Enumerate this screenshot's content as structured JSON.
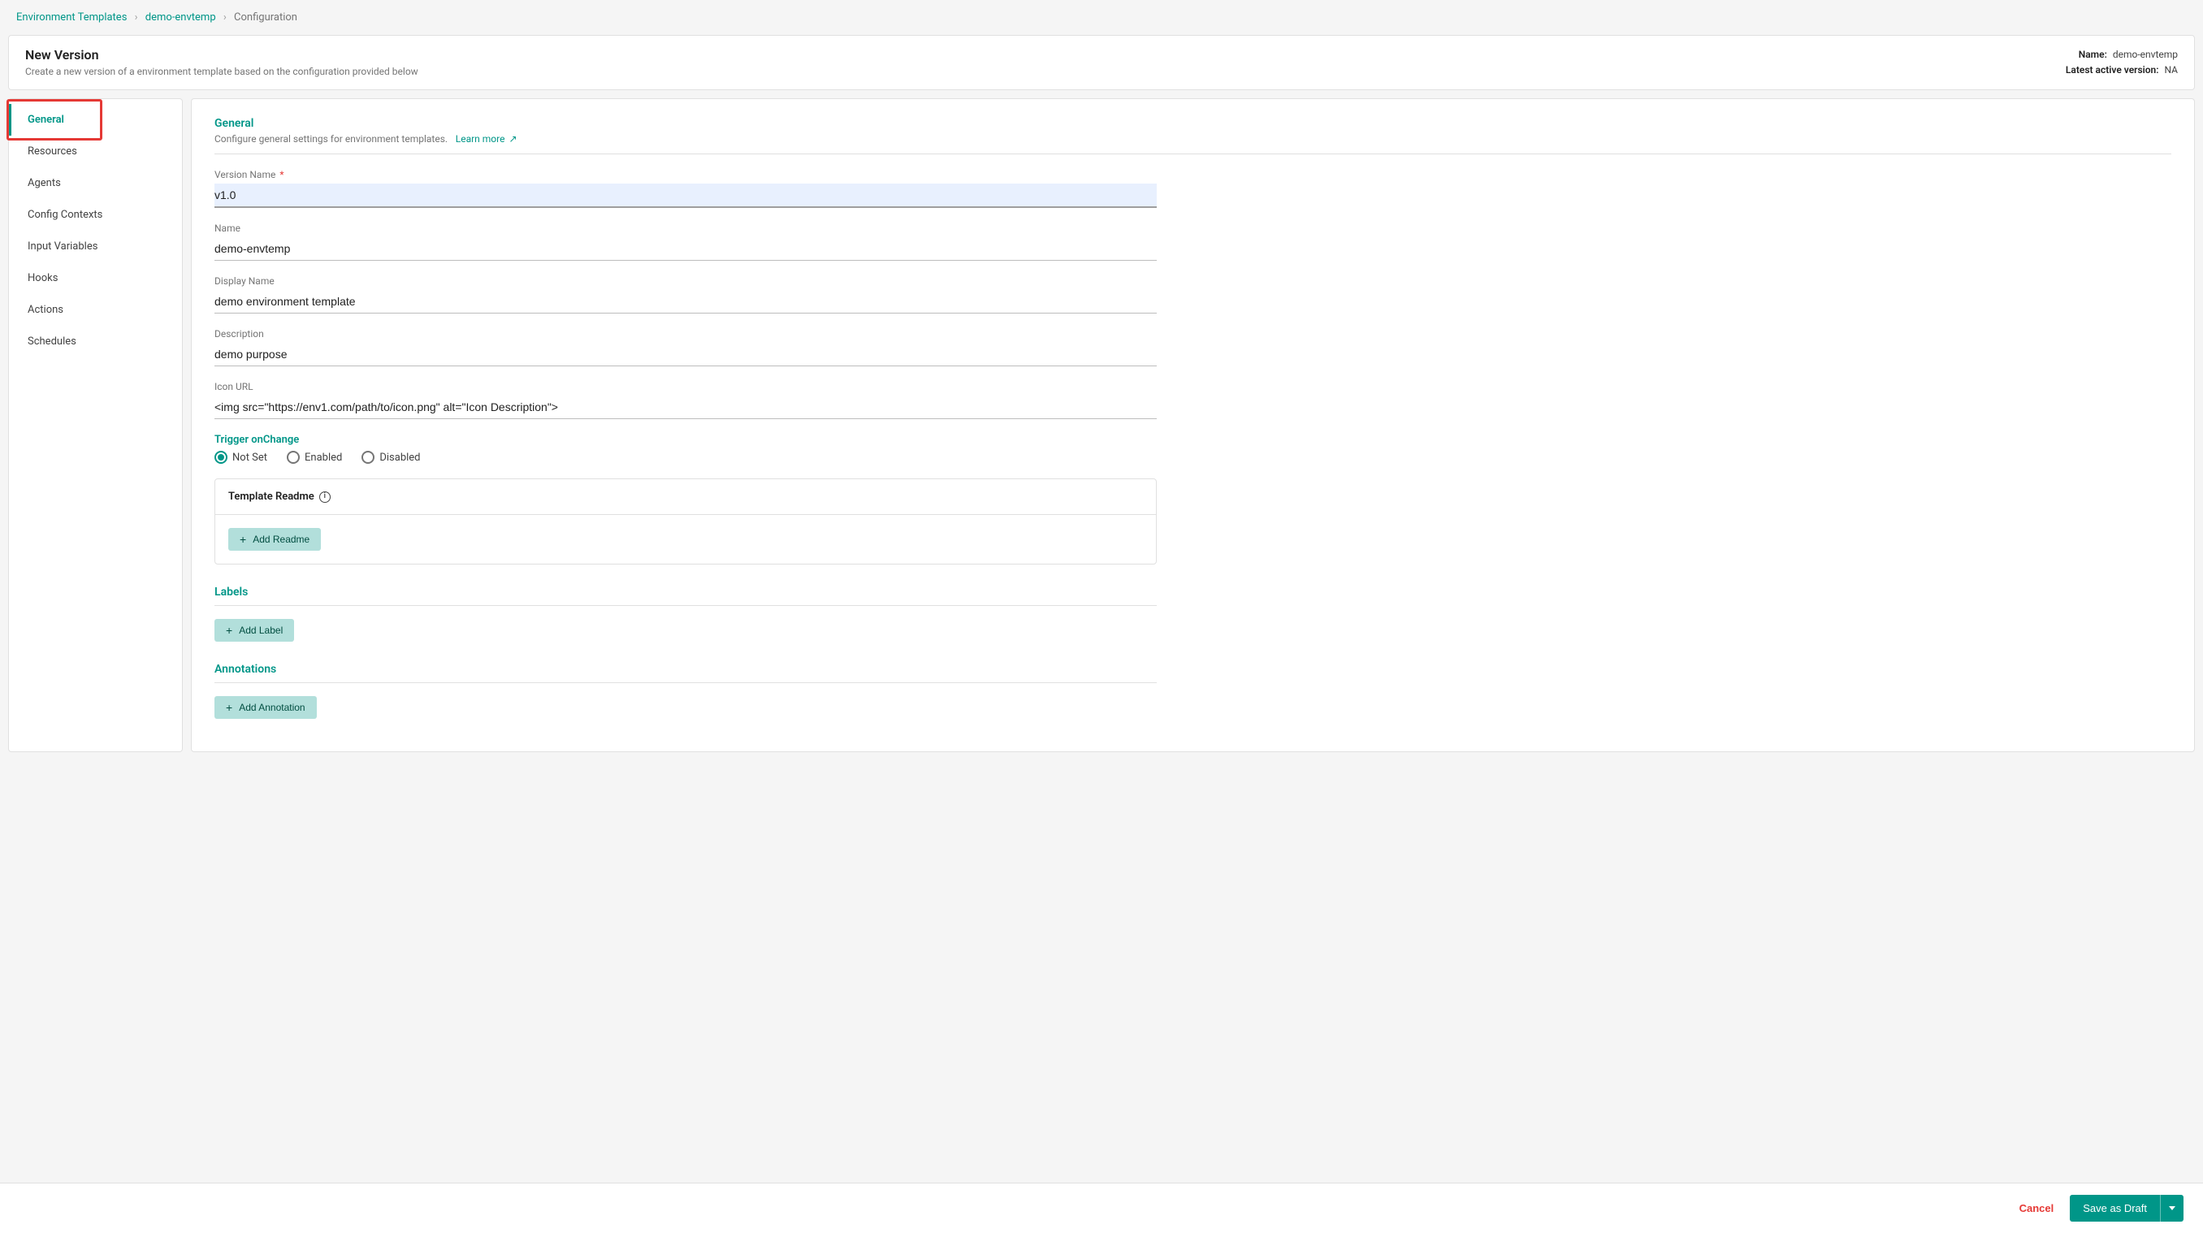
{
  "breadcrumb": {
    "root": "Environment Templates",
    "item": "demo-envtemp",
    "current": "Configuration"
  },
  "header": {
    "title": "New Version",
    "subtitle": "Create a new version of a environment template based on the configuration provided below",
    "name_label": "Name:",
    "name_value": "demo-envtemp",
    "latest_label": "Latest active version:",
    "latest_value": "NA"
  },
  "sidebar": {
    "items": [
      {
        "label": "General"
      },
      {
        "label": "Resources"
      },
      {
        "label": "Agents"
      },
      {
        "label": "Config Contexts"
      },
      {
        "label": "Input Variables"
      },
      {
        "label": "Hooks"
      },
      {
        "label": "Actions"
      },
      {
        "label": "Schedules"
      }
    ]
  },
  "general": {
    "title": "General",
    "subtitle": "Configure general settings for environment templates.",
    "learn_more": "Learn more"
  },
  "fields": {
    "version_name": {
      "label": "Version Name",
      "value": "v1.0"
    },
    "name": {
      "label": "Name",
      "value": "demo-envtemp"
    },
    "display_name": {
      "label": "Display Name",
      "value": "demo environment template"
    },
    "description": {
      "label": "Description",
      "value": "demo purpose"
    },
    "icon_url": {
      "label": "Icon URL",
      "value": "<img src=\"https://env1.com/path/to/icon.png\" alt=\"Icon Description\">"
    }
  },
  "trigger": {
    "title": "Trigger onChange",
    "options": {
      "not_set": "Not Set",
      "enabled": "Enabled",
      "disabled": "Disabled"
    },
    "selected": "not_set"
  },
  "readme": {
    "title": "Template Readme",
    "add_button": "Add Readme"
  },
  "labels_section": {
    "title": "Labels",
    "add_button": "Add Label"
  },
  "annotations_section": {
    "title": "Annotations",
    "add_button": "Add Annotation"
  },
  "footer": {
    "cancel": "Cancel",
    "save": "Save as Draft"
  }
}
